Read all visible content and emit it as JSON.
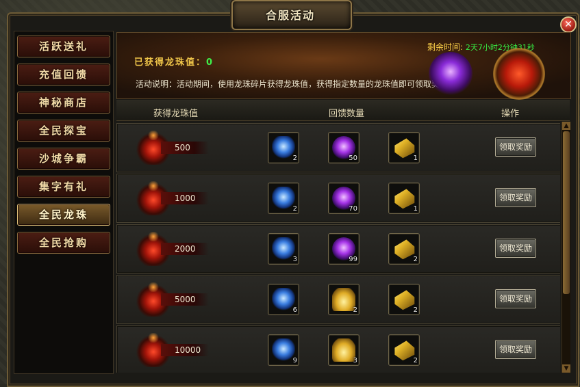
{
  "window": {
    "title": "合服活动"
  },
  "sidebar": {
    "items": [
      {
        "label": "活跃送礼",
        "active": false
      },
      {
        "label": "充值回馈",
        "active": false
      },
      {
        "label": "神秘商店",
        "active": false
      },
      {
        "label": "全民探宝",
        "active": false
      },
      {
        "label": "沙城争霸",
        "active": false
      },
      {
        "label": "集字有礼",
        "active": false
      },
      {
        "label": "全民龙珠",
        "active": true
      },
      {
        "label": "全民抢购",
        "active": false
      }
    ]
  },
  "banner": {
    "value_label": "已获得龙珠值：",
    "value": "0",
    "remaining_label": "剩余时间:",
    "countdown": "2天7小时2分钟31秒",
    "description": "活动说明：活动期间，使用龙珠碎片获得龙珠值，获得指定数量的龙珠值即可领取奖励"
  },
  "table": {
    "headers": {
      "value": "获得龙珠值",
      "rewards": "回馈数量",
      "action": "操作"
    },
    "rows": [
      {
        "requirement": "500",
        "rewards": [
          {
            "icon": "blue-crystal-icon",
            "qty": "2"
          },
          {
            "icon": "purple-orb-icon",
            "qty": "50"
          },
          {
            "icon": "gold-bars-icon",
            "qty": "1"
          }
        ],
        "button": "领取奖励"
      },
      {
        "requirement": "1000",
        "rewards": [
          {
            "icon": "blue-crystal-icon",
            "qty": "2"
          },
          {
            "icon": "purple-orb-icon",
            "qty": "70"
          },
          {
            "icon": "gold-bars-icon",
            "qty": "1"
          }
        ],
        "button": "领取奖励"
      },
      {
        "requirement": "2000",
        "rewards": [
          {
            "icon": "blue-crystal-icon",
            "qty": "3"
          },
          {
            "icon": "purple-orb-icon",
            "qty": "99"
          },
          {
            "icon": "gold-bars-icon",
            "qty": "2"
          }
        ],
        "button": "领取奖励"
      },
      {
        "requirement": "5000",
        "rewards": [
          {
            "icon": "blue-crystal-icon",
            "qty": "6"
          },
          {
            "icon": "gold-ingot-icon",
            "qty": "2"
          },
          {
            "icon": "gold-bars-icon",
            "qty": "2"
          }
        ],
        "button": "领取奖励"
      },
      {
        "requirement": "10000",
        "rewards": [
          {
            "icon": "blue-crystal-icon",
            "qty": "9"
          },
          {
            "icon": "gold-ingot-icon",
            "qty": "3"
          },
          {
            "icon": "gold-bars-icon",
            "qty": "2"
          }
        ],
        "button": "领取奖励"
      }
    ]
  },
  "colors": {
    "accent_gold": "#f0c64a",
    "countdown_green": "#37f045",
    "close_red": "#c0251a"
  }
}
